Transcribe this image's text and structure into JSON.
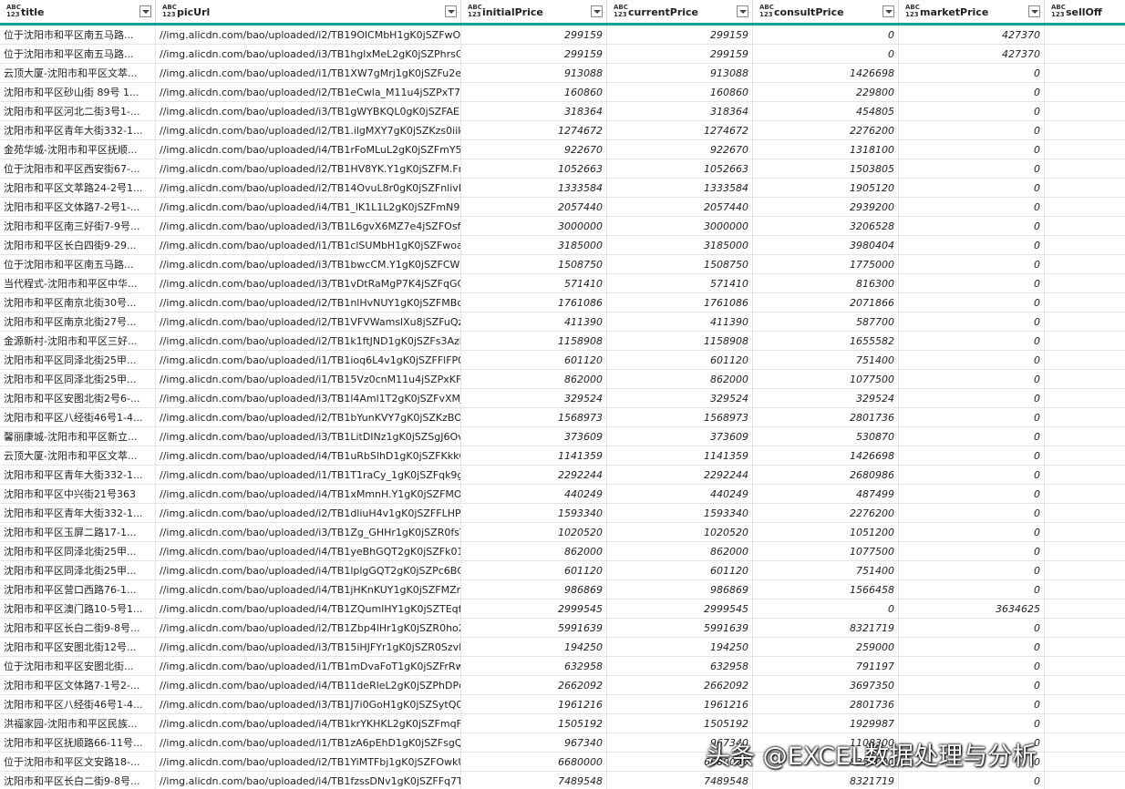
{
  "columns": [
    {
      "type": "ABC\n123",
      "name": "title"
    },
    {
      "type": "ABC\n123",
      "name": "picUrl"
    },
    {
      "type": "ABC\n123",
      "name": "initialPrice"
    },
    {
      "type": "ABC\n123",
      "name": "currentPrice"
    },
    {
      "type": "ABC\n123",
      "name": "consultPrice"
    },
    {
      "type": "ABC\n123",
      "name": "marketPrice"
    },
    {
      "type": "ABC\n123",
      "name": "sellOff"
    }
  ],
  "rows": [
    [
      "位于沈阳市和平区南五马路...",
      "//img.alicdn.com/bao/uploaded/i2/TB19OlCMbH1gK0jSZFwO3s7...",
      "299159",
      "299159",
      "0",
      "427370",
      ""
    ],
    [
      "位于沈阳市和平区南五马路...",
      "//img.alicdn.com/bao/uploaded/i3/TB1hglxMeL2gK0jSZPhrsGhv...",
      "299159",
      "299159",
      "0",
      "427370",
      ""
    ],
    [
      "云顶大厦-沈阳市和平区文萃...",
      "//img.alicdn.com/bao/uploaded/i1/TB1XW7gMrj1gK0jSZFu2elrH...",
      "913088",
      "913088",
      "1426698",
      "0",
      ""
    ],
    [
      "沈阳市和平区砂山街 89号 1...",
      "//img.alicdn.com/bao/uploaded/i2/TB1eCwla_M11u4jSZPxT7Shc...",
      "160860",
      "160860",
      "229800",
      "0",
      ""
    ],
    [
      "沈阳市和平区河北二街3号1-...",
      "//img.alicdn.com/bao/uploaded/i3/TB1gWYBKQL0gK0jSZFAENQ...",
      "318364",
      "318364",
      "454805",
      "0",
      ""
    ],
    [
      "沈阳市和平区青年大街332-1...",
      "//img.alicdn.com/bao/uploaded/i2/TB1.ilgMXY7gK0jSZKzs0iikpXa",
      "1274672",
      "1274672",
      "2276200",
      "0",
      ""
    ],
    [
      "金苑华城-沈阳市和平区抚顺...",
      "//img.alicdn.com/bao/uploaded/i4/TB1rFoMLuL2gK0jSZFmY5A7i...",
      "922670",
      "922670",
      "1318100",
      "0",
      ""
    ],
    [
      "位于沈阳市和平区西安街67-...",
      "//img.alicdn.com/bao/uploaded/i2/TB1HV8YK.Y1gK0jSZFM.FmW...",
      "1052663",
      "1052663",
      "1503805",
      "0",
      ""
    ],
    [
      "沈阳市和平区文萃路24-2号1...",
      "//img.alicdn.com/bao/uploaded/i2/TB14OvuL8r0gK0jSZFnlivRRXXa",
      "1333584",
      "1333584",
      "1905120",
      "0",
      ""
    ],
    [
      "沈阳市和平区文体路7-2号1-...",
      "//img.alicdn.com/bao/uploaded/i4/TB1_lK1L1L2gK0jSZFmN977iX...",
      "2057440",
      "2057440",
      "2939200",
      "0",
      ""
    ],
    [
      "沈阳市和平区南三好街7-9号...",
      "//img.alicdn.com/bao/uploaded/i3/TB1L6gvX6MZ7e4jSZFOsfx7e...",
      "3000000",
      "3000000",
      "3206528",
      "0",
      ""
    ],
    [
      "沈阳市和平区长白四街9-29...",
      "//img.alicdn.com/bao/uploaded/i1/TB1clSUMbH1gK0jSZFwoaU7...",
      "3185000",
      "3185000",
      "3980404",
      "0",
      ""
    ],
    [
      "位于沈阳市和平区南五马路...",
      "//img.alicdn.com/bao/uploaded/i3/TB1bwcCM.Y1gK0jSZFCWZ7...",
      "1508750",
      "1508750",
      "1775000",
      "0",
      ""
    ],
    [
      "当代程式-沈阳市和平区中华...",
      "//img.alicdn.com/bao/uploaded/i3/TB1vDtRaMgP7K4jSZFqGC5m...",
      "571410",
      "571410",
      "816300",
      "0",
      ""
    ],
    [
      "沈阳市和平区南京北街30号...",
      "//img.alicdn.com/bao/uploaded/i2/TB1nlHvNUY1gK0jSZFMBd1...",
      "1761086",
      "1761086",
      "2071866",
      "0",
      ""
    ],
    [
      "沈阳市和平区南京北街27号...",
      "//img.alicdn.com/bao/uploaded/i2/TB1VFVWamslXu8jSZFuQzhg...",
      "411390",
      "411390",
      "587700",
      "0",
      ""
    ],
    [
      "金源新村-沈阳市和平区三好...",
      "//img.alicdn.com/bao/uploaded/i2/TB1k1ftJND1gK0jSZFs3AzldVXa",
      "1158908",
      "1158908",
      "1655582",
      "0",
      ""
    ],
    [
      "沈阳市和平区同泽北街25甲...",
      "//img.alicdn.com/bao/uploaded/i1/TB1ioq6L4v1gK0jSZFFlFP0sXXa",
      "601120",
      "601120",
      "751400",
      "0",
      ""
    ],
    [
      "沈阳市和平区同泽北街25甲...",
      "//img.alicdn.com/bao/uploaded/i1/TB15Vz0cnM11u4jSZPxKFmh...",
      "862000",
      "862000",
      "1077500",
      "0",
      ""
    ],
    [
      "沈阳市和平区安图北街2号6-...",
      "//img.alicdn.com/bao/uploaded/i3/TB1l4Aml1T2gK0jSZFvXMJnF...",
      "329524",
      "329524",
      "329524",
      "0",
      ""
    ],
    [
      "沈阳市和平区八经街46号1-4...",
      "//img.alicdn.com/bao/uploaded/i2/TB1bYunKVY7gK0jSZKzBOmik...",
      "1568973",
      "1568973",
      "2801736",
      "0",
      ""
    ],
    [
      "馨丽康城-沈阳市和平区新立...",
      "//img.alicdn.com/bao/uploaded/i3/TB1LitDINz1gK0jSZSgJ6OvwpXa",
      "373609",
      "373609",
      "530870",
      "0",
      ""
    ],
    [
      "云顶大厦-沈阳市和平区文萃...",
      "//img.alicdn.com/bao/uploaded/i4/TB1uRbSlhD1gK0jSZFKkkQJrV...",
      "1141359",
      "1141359",
      "1426698",
      "0",
      ""
    ],
    [
      "沈阳市和平区青年大街332-1...",
      "//img.alicdn.com/bao/uploaded/i1/TB1T1raCy_1gK0jSZFqk9gpaX...",
      "2292244",
      "2292244",
      "2680986",
      "0",
      ""
    ],
    [
      "沈阳市和平区中兴街21号363",
      "//img.alicdn.com/bao/uploaded/i4/TB1xMmnH.Y1gK0jSZFMO0C...",
      "440249",
      "440249",
      "487499",
      "0",
      ""
    ],
    [
      "沈阳市和平区青年大街332-1...",
      "//img.alicdn.com/bao/uploaded/i2/TB1dliuH4v1gK0jSZFFLHP0sXXa",
      "1593340",
      "1593340",
      "2276200",
      "0",
      ""
    ],
    [
      "沈阳市和平区玉屏二路17-1...",
      "//img.alicdn.com/bao/uploaded/i3/TB1Zg_GHHr1gK0jSZR0fsTP8...",
      "1020520",
      "1020520",
      "1051200",
      "0",
      ""
    ],
    [
      "沈阳市和平区同泽北街25甲...",
      "//img.alicdn.com/bao/uploaded/i4/TB1yeBhGQT2gK0jSZFk01slQ...",
      "862000",
      "862000",
      "1077500",
      "0",
      ""
    ],
    [
      "沈阳市和平区同泽北街25甲...",
      "//img.alicdn.com/bao/uploaded/i4/TB1lplgGQT2gK0jSZPc6BQKk...",
      "601120",
      "601120",
      "751400",
      "0",
      ""
    ],
    [
      "沈阳市和平区营口西路76-1...",
      "//img.alicdn.com/bao/uploaded/i4/TB1jHKnKUY1gK0jSZFMZnKW...",
      "986869",
      "986869",
      "1566458",
      "0",
      ""
    ],
    [
      "沈阳市和平区澳门路10-5号1...",
      "//img.alicdn.com/bao/uploaded/i4/TB1ZQumlHY1gK0jSZTEqfdD...",
      "2999545",
      "2999545",
      "0",
      "3634625",
      ""
    ],
    [
      "沈阳市和平区长白二街9-8号...",
      "//img.alicdn.com/bao/uploaded/i2/TB1Zbp4lHr1gK0jSZR0ho2P8...",
      "5991639",
      "5991639",
      "8321719",
      "0",
      ""
    ],
    [
      "沈阳市和平区安图北街12号...",
      "//img.alicdn.com/bao/uploaded/i3/TB15iHJFYr1gK0jSZR0SzvP8XXa",
      "194250",
      "194250",
      "259000",
      "0",
      ""
    ],
    [
      "位于沈阳市和平区安图北街...",
      "//img.alicdn.com/bao/uploaded/i1/TB1mDvaFoT1gK0jSZFrRwkN...",
      "632958",
      "632958",
      "791197",
      "0",
      ""
    ],
    [
      "沈阳市和平区文体路7-1号2-...",
      "//img.alicdn.com/bao/uploaded/i4/TB11deRleL2gK0jSZPhDPqhv...",
      "2662092",
      "2662092",
      "3697350",
      "0",
      ""
    ],
    [
      "沈阳市和平区八经街46号1-4...",
      "//img.alicdn.com/bao/uploaded/i3/TB1J7i0GoH1gK0jSZSytQ0tlpXa",
      "1961216",
      "1961216",
      "2801736",
      "0",
      ""
    ],
    [
      "洪福家园-沈阳市和平区民族...",
      "//img.alicdn.com/bao/uploaded/i4/TB1krYKHKL2gK0jSZFmqF37i...",
      "1505192",
      "1505192",
      "1929987",
      "0",
      ""
    ],
    [
      "沈阳市和平区抚顺路66-11号...",
      "//img.alicdn.com/bao/uploaded/i1/TB1zA6pEhD1gK0jSZFsgQDld...",
      "967340",
      "967340",
      "1108300",
      "0",
      ""
    ],
    [
      "位于沈阳市和平区文安路18-...",
      "//img.alicdn.com/bao/uploaded/i2/TB1YiMTFbj1gK0jSZFOwkU7G...",
      "6680000",
      "6680000",
      "8350000",
      "0",
      ""
    ],
    [
      "沈阳市和平区长白二街9-8号...",
      "//img.alicdn.com/bao/uploaded/i4/TB1fzssDNv1gK0jSZFFq7T0sX...",
      "7489548",
      "7489548",
      "8321719",
      "0",
      ""
    ]
  ],
  "watermark": "头条 @EXCEL数据处理与分析"
}
